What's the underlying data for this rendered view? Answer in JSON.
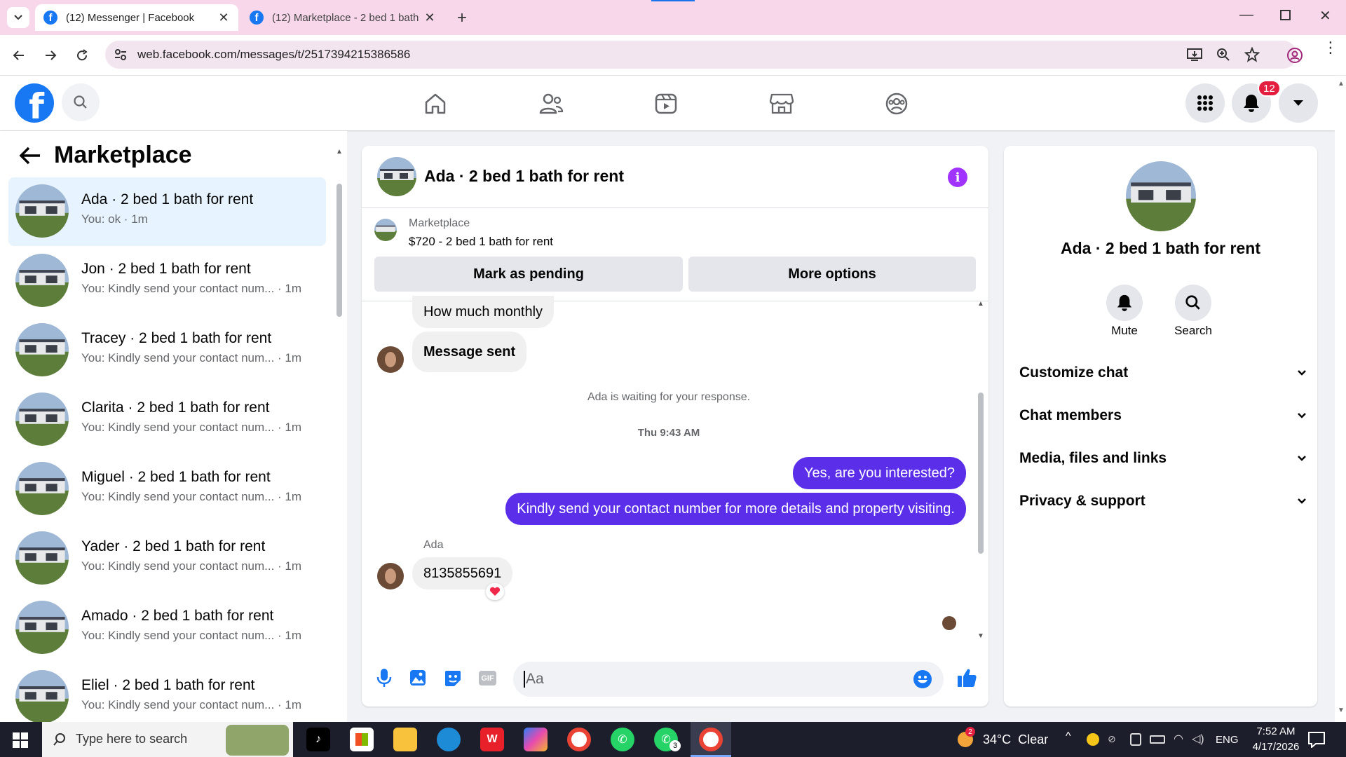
{
  "browser": {
    "tabs": [
      {
        "title": "(12) Messenger | Facebook"
      },
      {
        "title": "(12) Marketplace - 2 bed 1 bath"
      }
    ],
    "url": "web.facebook.com/messages/t/2517394215386586"
  },
  "fb": {
    "notification_count": "12"
  },
  "left_pane": {
    "title": "Marketplace",
    "conversations": [
      {
        "name": "Ada · 2 bed 1 bath for rent",
        "preview": "You: ok · 1m"
      },
      {
        "name": "Jon · 2 bed 1 bath for rent",
        "preview": "You: Kindly send your contact num... · 1m"
      },
      {
        "name": "Tracey · 2 bed 1 bath for rent",
        "preview": "You: Kindly send your contact num... · 1m"
      },
      {
        "name": "Clarita · 2 bed 1 bath for rent",
        "preview": "You: Kindly send your contact num... · 1m"
      },
      {
        "name": "Miguel · 2 bed 1 bath for rent",
        "preview": "You: Kindly send your contact num... · 1m"
      },
      {
        "name": "Yader · 2 bed 1 bath for rent",
        "preview": "You: Kindly send your contact num... · 1m"
      },
      {
        "name": "Amado · 2 bed 1 bath for rent",
        "preview": "You: Kindly send your contact num... · 1m"
      },
      {
        "name": "Eliel · 2 bed 1 bath for rent",
        "preview": "You: Kindly send your contact num... · 1m"
      }
    ]
  },
  "chat": {
    "header_title": "Ada · 2 bed 1 bath for rent",
    "listing_label": "Marketplace",
    "listing_detail": "$720 - 2 bed 1 bath for rent",
    "mark_pending": "Mark as pending",
    "more_options": "More options",
    "msg_how_much": "How much monthly",
    "msg_sent": "Message sent",
    "waiting": "Ada is waiting for your response.",
    "timestamp": "Thu 9:43 AM",
    "out_1": "Yes, are you interested?",
    "out_2": "Kindly send your contact number for more details and property visiting.",
    "sender": "Ada",
    "in_number": "8135855691",
    "reaction": "❤️",
    "composer_placeholder": "Aa"
  },
  "right_pane": {
    "name": "Ada · 2 bed 1 bath for rent",
    "mute": "Mute",
    "search": "Search",
    "sections": [
      "Customize chat",
      "Chat members",
      "Media, files and links",
      "Privacy & support"
    ]
  },
  "taskbar": {
    "search_placeholder": "Type here to search",
    "weather_badge": "2",
    "weather": "34°C  Clear",
    "lang": "ENG",
    "time": "7:52 AM",
    "date": "4/17/2026",
    "whatsapp_badge": "3"
  },
  "colors": {
    "accent": "#5b2eea",
    "fb_blue": "#1877f2",
    "notification_red": "#e41e3f",
    "info_purple": "#a033ff"
  }
}
